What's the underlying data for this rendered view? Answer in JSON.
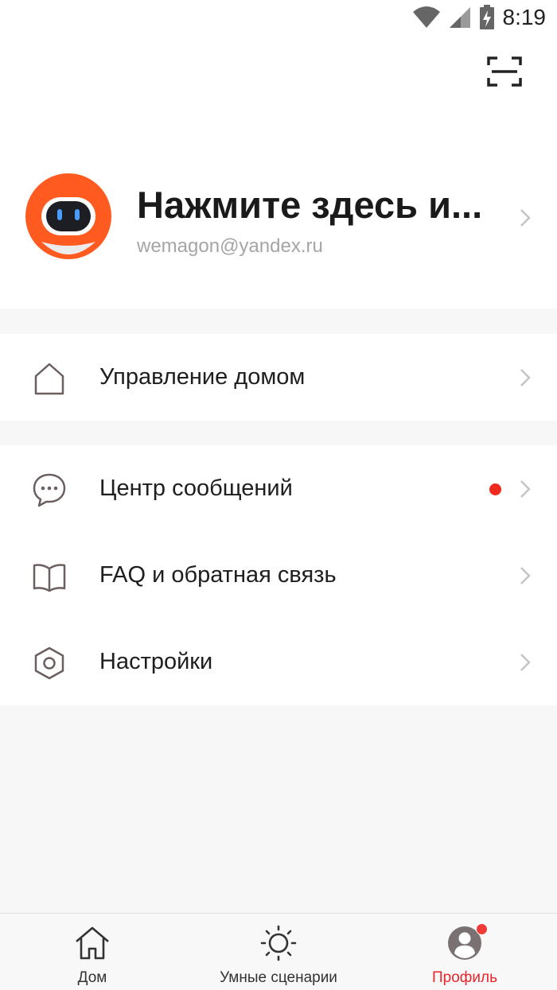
{
  "status_bar": {
    "time": "8:19"
  },
  "header": {
    "scan_icon": "scan-icon"
  },
  "profile": {
    "name": "Нажмите здесь и...",
    "email": "wemagon@yandex.ru",
    "avatar_icon": "robot-avatar"
  },
  "menu_group_1": [
    {
      "label": "Управление домом",
      "icon": "home-icon"
    }
  ],
  "menu_group_2": [
    {
      "label": "Центр сообщений",
      "icon": "message-icon",
      "has_badge": true
    },
    {
      "label": "FAQ и обратная связь",
      "icon": "book-icon"
    },
    {
      "label": "Настройки",
      "icon": "settings-icon"
    }
  ],
  "tabs": [
    {
      "label": "Дом",
      "icon": "home-icon",
      "active": false
    },
    {
      "label": "Умные сценарии",
      "icon": "sun-icon",
      "active": false
    },
    {
      "label": "Профиль",
      "icon": "profile-icon",
      "active": true,
      "has_badge": true
    }
  ],
  "colors": {
    "accent": "#e8262a",
    "avatar_orange": "#ff5a1f",
    "badge_red": "#ee2a1e",
    "background": "#f7f7f7"
  }
}
